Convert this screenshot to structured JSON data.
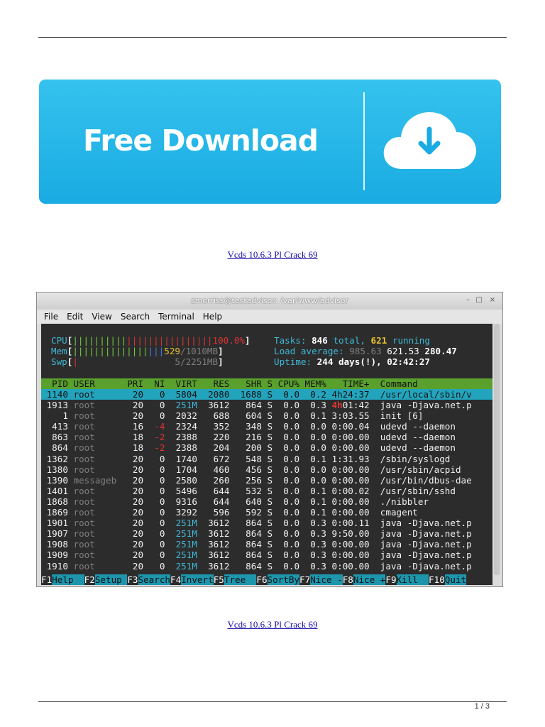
{
  "banner": {
    "label": "Free Download"
  },
  "links": {
    "top": "Vcds 10.6.3 Pl Crack 69",
    "bottom": "Vcds 10.6.3 Pl Crack 69"
  },
  "page_number": "1 / 3",
  "terminal": {
    "title": "smorriss@testadvisor: /var/www/advisor",
    "window_controls": [
      "–",
      "□",
      "×"
    ],
    "menu": [
      "File",
      "Edit",
      "View",
      "Search",
      "Terminal",
      "Help"
    ],
    "meters": {
      "cpu_label": "CPU",
      "cpu_bar_green": "||||||||||",
      "cpu_bar_red": "||||||||||||||||",
      "cpu_value": "100.0%",
      "mem_label": "Mem",
      "mem_bar_green": "||||||||||||||",
      "mem_bar_blue": "|||",
      "mem_used": "529",
      "mem_total": "1010MB",
      "swp_label": "Swp",
      "swp_bar": "|",
      "swp_value": "5/2251MB"
    },
    "stats": {
      "tasks_label": "Tasks:",
      "tasks_total": "846",
      "tasks_total_word": "total,",
      "tasks_running": "621",
      "tasks_running_word": "running",
      "load_label": "Load average:",
      "load1": "985.63",
      "load5": "621.53",
      "load15": "280.47",
      "uptime_label": "Uptime:",
      "uptime_value": "244 days(!),",
      "uptime_time": "02:42:27"
    },
    "header": "  PID USER      PRI  NI  VIRT   RES   SHR S CPU% MEM%   TIME+  Command",
    "processes": [
      {
        "pid": "1140",
        "user": "root",
        "pri": "20",
        "ni": "0",
        "virt": "5804",
        "res": "2080",
        "shr": "1688",
        "s": "S",
        "cpu": "0.0",
        "mem": "0.2",
        "time": "4h24:37",
        "cmd": "/usr/local/sbin/v",
        "selected": true
      },
      {
        "pid": "1913",
        "user": "root",
        "pri": "20",
        "ni": "0",
        "virt": "251M",
        "res": "3612",
        "shr": "864",
        "s": "S",
        "cpu": "0.0",
        "mem": "0.3",
        "time_hi": "4h",
        "time": "01:42",
        "cmd": "java -Djava.net.p"
      },
      {
        "pid": "1",
        "user": "root",
        "pri": "20",
        "ni": "0",
        "virt": "2032",
        "res": "688",
        "shr": "604",
        "s": "S",
        "cpu": "0.0",
        "mem": "0.1",
        "time": "3:03.55",
        "cmd": "init [6]"
      },
      {
        "pid": "413",
        "user": "root",
        "pri": "16",
        "ni": "-4",
        "virt": "2324",
        "res": "352",
        "shr": "348",
        "s": "S",
        "cpu": "0.0",
        "mem": "0.0",
        "time": "0:00.04",
        "cmd": "udevd --daemon"
      },
      {
        "pid": "863",
        "user": "root",
        "pri": "18",
        "ni": "-2",
        "virt": "2388",
        "res": "220",
        "shr": "216",
        "s": "S",
        "cpu": "0.0",
        "mem": "0.0",
        "time": "0:00.00",
        "cmd": "udevd --daemon"
      },
      {
        "pid": "864",
        "user": "root",
        "pri": "18",
        "ni": "-2",
        "virt": "2388",
        "res": "204",
        "shr": "200",
        "s": "S",
        "cpu": "0.0",
        "mem": "0.0",
        "time": "0:00.00",
        "cmd": "udevd --daemon"
      },
      {
        "pid": "1362",
        "user": "root",
        "pri": "20",
        "ni": "0",
        "virt": "1740",
        "res": "672",
        "shr": "548",
        "s": "S",
        "cpu": "0.0",
        "mem": "0.1",
        "time": "1:31.93",
        "cmd": "/sbin/syslogd"
      },
      {
        "pid": "1380",
        "user": "root",
        "pri": "20",
        "ni": "0",
        "virt": "1704",
        "res": "460",
        "shr": "456",
        "s": "S",
        "cpu": "0.0",
        "mem": "0.0",
        "time": "0:00.00",
        "cmd": "/usr/sbin/acpid"
      },
      {
        "pid": "1390",
        "user": "messageb",
        "pri": "20",
        "ni": "0",
        "virt": "2580",
        "res": "260",
        "shr": "256",
        "s": "S",
        "cpu": "0.0",
        "mem": "0.0",
        "time": "0:00.00",
        "cmd": "/usr/bin/dbus-dae"
      },
      {
        "pid": "1401",
        "user": "root",
        "pri": "20",
        "ni": "0",
        "virt": "5496",
        "res": "644",
        "shr": "532",
        "s": "S",
        "cpu": "0.0",
        "mem": "0.1",
        "time": "0:00.02",
        "cmd": "/usr/sbin/sshd"
      },
      {
        "pid": "1868",
        "user": "root",
        "pri": "20",
        "ni": "0",
        "virt": "9316",
        "res": "644",
        "shr": "640",
        "s": "S",
        "cpu": "0.0",
        "mem": "0.1",
        "time": "0:00.00",
        "cmd": "./nibbler"
      },
      {
        "pid": "1869",
        "user": "root",
        "pri": "20",
        "ni": "0",
        "virt": "3292",
        "res": "596",
        "shr": "592",
        "s": "S",
        "cpu": "0.0",
        "mem": "0.1",
        "time": "0:00.00",
        "cmd": "cmagent"
      },
      {
        "pid": "1901",
        "user": "root",
        "pri": "20",
        "ni": "0",
        "virt": "251M",
        "res": "3612",
        "shr": "864",
        "s": "S",
        "cpu": "0.0",
        "mem": "0.3",
        "time": "0:00.11",
        "cmd": "java -Djava.net.p"
      },
      {
        "pid": "1907",
        "user": "root",
        "pri": "20",
        "ni": "0",
        "virt": "251M",
        "res": "3612",
        "shr": "864",
        "s": "S",
        "cpu": "0.0",
        "mem": "0.3",
        "time": "9:50.00",
        "cmd": "java -Djava.net.p"
      },
      {
        "pid": "1908",
        "user": "root",
        "pri": "20",
        "ni": "0",
        "virt": "251M",
        "res": "3612",
        "shr": "864",
        "s": "S",
        "cpu": "0.0",
        "mem": "0.3",
        "time": "0:00.00",
        "cmd": "java -Djava.net.p"
      },
      {
        "pid": "1909",
        "user": "root",
        "pri": "20",
        "ni": "0",
        "virt": "251M",
        "res": "3612",
        "shr": "864",
        "s": "S",
        "cpu": "0.0",
        "mem": "0.3",
        "time": "0:00.00",
        "cmd": "java -Djava.net.p"
      },
      {
        "pid": "1910",
        "user": "root",
        "pri": "20",
        "ni": "0",
        "virt": "251M",
        "res": "3612",
        "shr": "864",
        "s": "S",
        "cpu": "0.0",
        "mem": "0.3",
        "time": "0:00.00",
        "cmd": "java -Djava.net.p"
      }
    ],
    "function_keys": [
      {
        "key": "F1",
        "label": "Help"
      },
      {
        "key": "F2",
        "label": "Setup"
      },
      {
        "key": "F3",
        "label": "Search"
      },
      {
        "key": "F4",
        "label": "Invert"
      },
      {
        "key": "F5",
        "label": "Tree"
      },
      {
        "key": "F6",
        "label": "SortBy"
      },
      {
        "key": "F7",
        "label": "Nice -"
      },
      {
        "key": "F8",
        "label": "Nice +"
      },
      {
        "key": "F9",
        "label": "Kill"
      },
      {
        "key": "F10",
        "label": "Quit"
      }
    ]
  },
  "colors": {
    "banner_blue": "#19abe2",
    "link": "#1a0dab",
    "htop_header": "#5aa02c",
    "htop_selected": "#23a4bd"
  }
}
